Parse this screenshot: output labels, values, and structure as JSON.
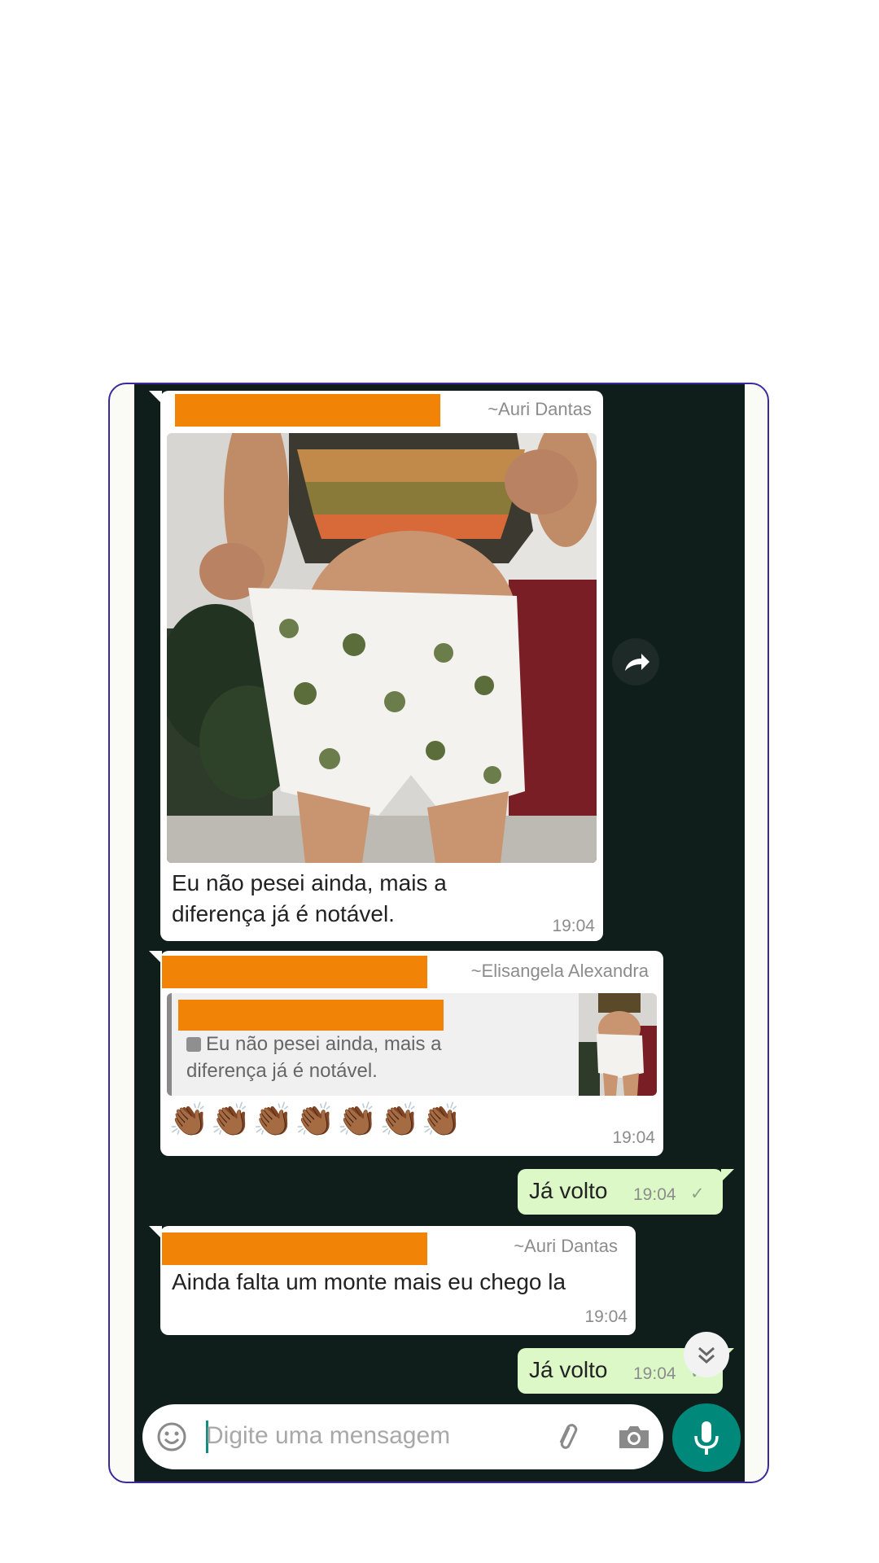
{
  "messages": [
    {
      "sender": "~Auri Dantas",
      "text_line1": "Eu não pesei ainda,  mais a",
      "text_line2": "diferença já é notável.",
      "time": "19:04"
    },
    {
      "sender": "~Elisangela Alexandra",
      "quote_line1": "Eu não pesei ainda,  mais a",
      "quote_line2": "diferença já é notável.",
      "emojis": "👏🏾👏🏾👏🏾👏🏾👏🏾👏🏾👏🏾",
      "time": "19:04"
    },
    {
      "text": "Já volto",
      "time": "19:04",
      "status": "✓"
    },
    {
      "sender": "~Auri Dantas",
      "text": "Ainda falta um monte mais eu chego la",
      "time": "19:04"
    },
    {
      "text": "Já volto",
      "time": "19:04",
      "status": "✓"
    }
  ],
  "composer": {
    "placeholder": "Digite uma mensagem"
  },
  "icons": {
    "emoji": "smiley-icon",
    "attach": "paperclip-icon",
    "camera": "camera-icon",
    "mic": "microphone-icon",
    "forward": "forward-icon",
    "scroll": "chevron-double-down-icon",
    "image": "image-icon"
  },
  "colors": {
    "chat_background": "#0f1e1a",
    "outgoing_bubble": "#dcf8c6",
    "incoming_bubble": "#ffffff",
    "redaction": "#f18406",
    "accent": "#00897b"
  }
}
